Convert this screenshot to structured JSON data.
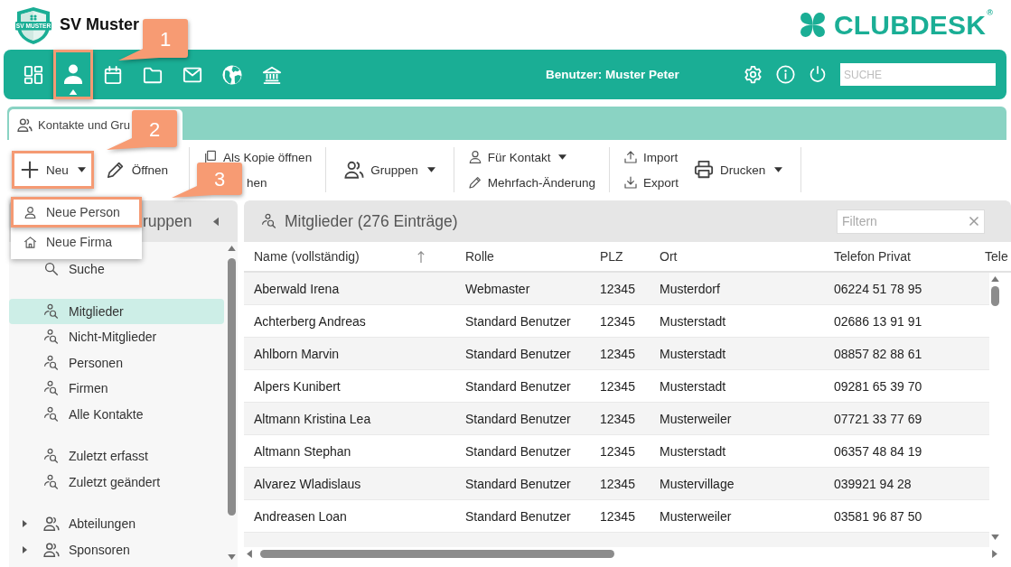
{
  "header": {
    "logo_text": "SV MUSTER",
    "club_name": "SV Muster",
    "brand": "CLUBDESK$^{®}$"
  },
  "nav": {
    "items": [
      {
        "selected": false,
        "highlighted": false
      },
      {
        "selected": true,
        "highlighted": true
      },
      {
        "selected": false,
        "highlighted": false
      },
      {
        "selected": false,
        "highlighted": false
      },
      {
        "selected": false,
        "highlighted": false
      },
      {
        "selected": false,
        "highlighted": false
      },
      {
        "selected": false,
        "highlighted": false
      }
    ],
    "user": "Benutzer: Muster Peter",
    "search": {
      "placeholder": "SUCHE"
    }
  },
  "tabs": [
    {
      "label": "Kontakte und Gru",
      "selected": true
    }
  ],
  "toolbar": {
    "sections": [
      {
        "columns": [
          [
            {
              "label": "Neu",
              "dropdown": true,
              "highlighted": true
            }
          ],
          [
            {
              "label": "Öffnen",
              "dropdown": false,
              "highlighted": false
            }
          ]
        ]
      },
      {
        "columns": [
          [
            {
              "label": "Als Kopie öffnen",
              "dropdown": false,
              "highlighted": false
            },
            {
              "label": "hen",
              "dropdown": false,
              "highlighted": false
            }
          ]
        ]
      },
      {
        "columns": [
          [
            {
              "label": "Gruppen",
              "dropdown": true,
              "highlighted": false
            }
          ]
        ]
      },
      {
        "columns": [
          [
            {
              "label": "Für Kontakt",
              "dropdown": true,
              "highlighted": false
            },
            {
              "label": "Mehrfach-Änderung",
              "dropdown": false,
              "highlighted": false
            }
          ]
        ]
      },
      {
        "columns": [
          [
            {
              "label": "Import",
              "dropdown": false,
              "highlighted": false
            },
            {
              "label": "Export",
              "dropdown": false,
              "highlighted": false
            }
          ],
          [
            {
              "label": "Drucken",
              "dropdown": true,
              "highlighted": false
            }
          ]
        ]
      }
    ]
  },
  "new_menu": {
    "items": [
      {
        "label": "Neue Person",
        "highlighted": true
      },
      {
        "label": "Neue Firma",
        "highlighted": false
      }
    ]
  },
  "sidebar": {
    "title": "ruppen",
    "sections": [
      {
        "items": [
          {
            "kind": "search",
            "label": "Suche",
            "selected": false
          }
        ]
      },
      {
        "items": [
          {
            "kind": "query",
            "label": "Mitglieder",
            "selected": true
          },
          {
            "kind": "query",
            "label": "Nicht-Mitglieder",
            "selected": false
          },
          {
            "kind": "query",
            "label": "Personen",
            "selected": false
          },
          {
            "kind": "query",
            "label": "Firmen",
            "selected": false
          },
          {
            "kind": "query",
            "label": "Alle Kontakte",
            "selected": false
          }
        ]
      },
      {
        "items": [
          {
            "kind": "query",
            "label": "Zuletzt erfasst",
            "selected": false
          },
          {
            "kind": "query",
            "label": "Zuletzt geändert",
            "selected": false
          }
        ]
      },
      {
        "items": [
          {
            "kind": "group",
            "label": "Abteilungen",
            "selected": false,
            "expanded": false
          },
          {
            "kind": "group",
            "label": "Sponsoren",
            "selected": false,
            "expanded": false
          }
        ]
      }
    ]
  },
  "list": {
    "title": "Mitglieder (276 Einträge)",
    "filter": {
      "placeholder": "Filtern"
    },
    "table": {
      "columns": [
        {
          "label": "Name (vollständig)",
          "sorted": true
        },
        {
          "label": "Rolle",
          "sorted": false
        },
        {
          "label": "PLZ",
          "sorted": false
        },
        {
          "label": "Ort",
          "sorted": false
        },
        {
          "label": "Telefon Privat",
          "sorted": false
        },
        {
          "label": "Tele",
          "sorted": false
        }
      ],
      "rows": [
        [
          "Aberwald Irena",
          "Webmaster",
          "12345",
          "Musterdorf",
          "06224 51 78 95"
        ],
        [
          "Achterberg Andreas",
          "Standard Benutzer",
          "12345",
          "Musterstadt",
          "02686 13 91 91"
        ],
        [
          "Ahlborn Marvin",
          "Standard Benutzer",
          "12345",
          "Musterstadt",
          "08857 82 88 61"
        ],
        [
          "Alpers Kunibert",
          "Standard Benutzer",
          "12345",
          "Musterstadt",
          "09281 65 39 70"
        ],
        [
          "Altmann Kristina Lea",
          "Standard Benutzer",
          "12345",
          "Musterweiler",
          "07721 33 77 69"
        ],
        [
          "Altmann Stephan",
          "Standard Benutzer",
          "12345",
          "Musterstadt",
          "06357 48 84 19"
        ],
        [
          "Alvarez Wladislaus",
          "Standard Benutzer",
          "12345",
          "Mustervillage",
          "039921 94 28"
        ],
        [
          "Andreasen Loan",
          "Standard Benutzer",
          "12345",
          "Musterweiler",
          "03581 96 87 50"
        ]
      ]
    }
  },
  "callouts": [
    {
      "label": "1"
    },
    {
      "label": "2"
    },
    {
      "label": "3"
    }
  ]
}
